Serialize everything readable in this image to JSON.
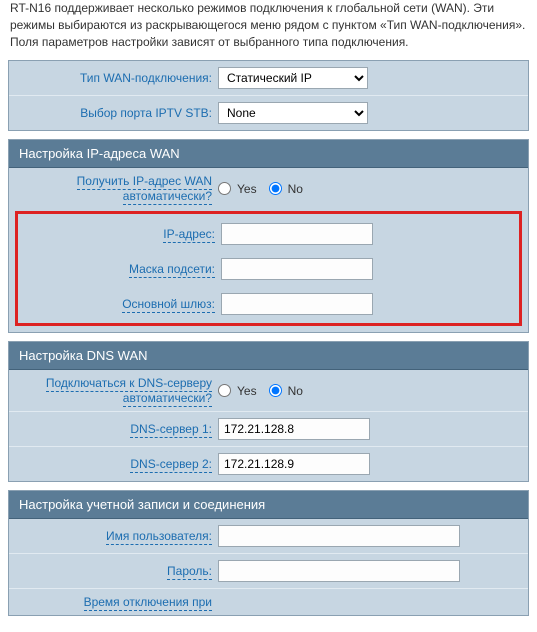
{
  "intro": "RT-N16 поддерживает несколько режимов подключения к глобальной сети (WAN). Эти режимы выбираются из раскрывающегося меню рядом с пунктом «Тип WAN-подключения». Поля параметров настройки зависят от выбранного типа подключения.",
  "top": {
    "wan_type_label": "Тип WAN-подключения:",
    "wan_type_value": "Статический IP",
    "iptv_port_label": "Выбор порта IPTV STB:",
    "iptv_port_value": "None"
  },
  "wan_ip": {
    "header": "Настройка IP-адреса WAN",
    "auto_label": "Получить IP-адрес WAN автоматически?",
    "yes": "Yes",
    "no": "No",
    "ip_label": "IP-адрес:",
    "ip_value": "",
    "mask_label": "Маска подсети:",
    "mask_value": "",
    "gw_label": "Основной шлюз:",
    "gw_value": ""
  },
  "dns": {
    "header": "Настройка DNS WAN",
    "auto_label": "Подключаться к DNS-серверу автоматически?",
    "yes": "Yes",
    "no": "No",
    "dns1_label": "DNS-сервер 1:",
    "dns1_value": "172.21.128.8",
    "dns2_label": "DNS-сервер 2:",
    "dns2_value": "172.21.128.9"
  },
  "acct": {
    "header": "Настройка учетной записи и соединения",
    "user_label": "Имя пользователя:",
    "user_value": "",
    "pass_label": "Пароль:",
    "pass_value": "",
    "disc_label": "Время отключения при"
  }
}
